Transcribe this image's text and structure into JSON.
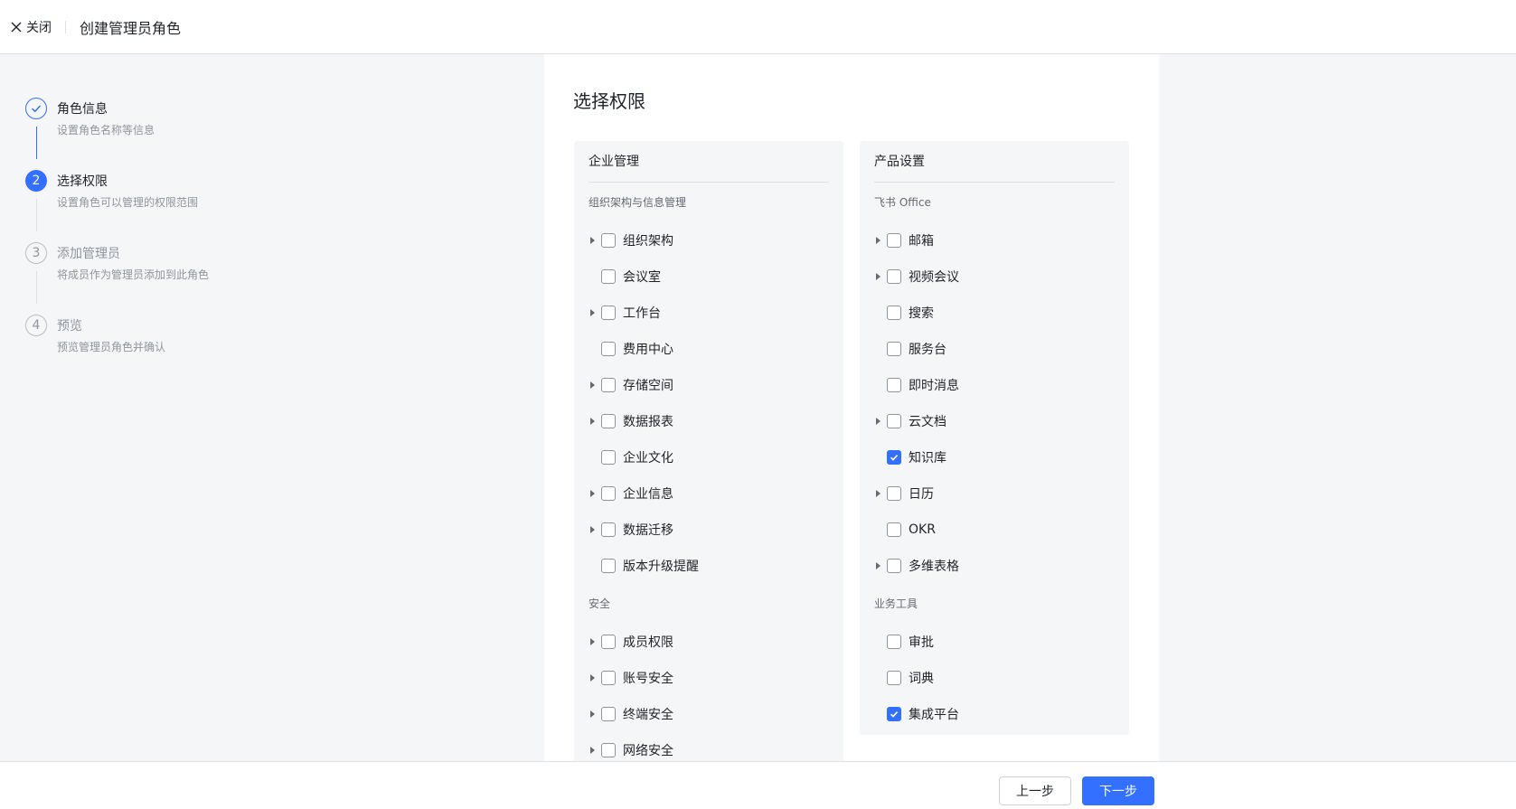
{
  "header": {
    "close_label": "关闭",
    "title": "创建管理员角色"
  },
  "steps": [
    {
      "title": "角色信息",
      "desc": "设置角色名称等信息",
      "status": "done"
    },
    {
      "number": "2",
      "title": "选择权限",
      "desc": "设置角色可以管理的权限范围",
      "status": "active"
    },
    {
      "number": "3",
      "title": "添加管理员",
      "desc": "将成员作为管理员添加到此角色",
      "status": "pending"
    },
    {
      "number": "4",
      "title": "预览",
      "desc": "预览管理员角色并确认",
      "status": "pending"
    }
  ],
  "main": {
    "title": "选择权限",
    "left_panel": {
      "header": "企业管理",
      "groups": [
        {
          "label": "组织架构与信息管理",
          "items": [
            {
              "label": "组织架构",
              "expandable": true,
              "checked": false
            },
            {
              "label": "会议室",
              "expandable": false,
              "checked": false
            },
            {
              "label": "工作台",
              "expandable": true,
              "checked": false
            },
            {
              "label": "费用中心",
              "expandable": false,
              "checked": false
            },
            {
              "label": "存储空间",
              "expandable": true,
              "checked": false
            },
            {
              "label": "数据报表",
              "expandable": true,
              "checked": false
            },
            {
              "label": "企业文化",
              "expandable": false,
              "checked": false
            },
            {
              "label": "企业信息",
              "expandable": true,
              "checked": false
            },
            {
              "label": "数据迁移",
              "expandable": true,
              "checked": false
            },
            {
              "label": "版本升级提醒",
              "expandable": false,
              "checked": false
            }
          ]
        },
        {
          "label": "安全",
          "items": [
            {
              "label": "成员权限",
              "expandable": true,
              "checked": false
            },
            {
              "label": "账号安全",
              "expandable": true,
              "checked": false
            },
            {
              "label": "终端安全",
              "expandable": true,
              "checked": false
            },
            {
              "label": "网络安全",
              "expandable": true,
              "checked": false
            }
          ]
        }
      ]
    },
    "right_panel": {
      "header": "产品设置",
      "groups": [
        {
          "label": "飞书 Office",
          "items": [
            {
              "label": "邮箱",
              "expandable": true,
              "checked": false
            },
            {
              "label": "视频会议",
              "expandable": true,
              "checked": false
            },
            {
              "label": "搜索",
              "expandable": false,
              "checked": false
            },
            {
              "label": "服务台",
              "expandable": false,
              "checked": false
            },
            {
              "label": "即时消息",
              "expandable": false,
              "checked": false
            },
            {
              "label": "云文档",
              "expandable": true,
              "checked": false
            },
            {
              "label": "知识库",
              "expandable": false,
              "checked": true
            },
            {
              "label": "日历",
              "expandable": true,
              "checked": false
            },
            {
              "label": "OKR",
              "expandable": false,
              "checked": false
            },
            {
              "label": "多维表格",
              "expandable": true,
              "checked": false
            }
          ]
        },
        {
          "label": "业务工具",
          "items": [
            {
              "label": "审批",
              "expandable": false,
              "checked": false
            },
            {
              "label": "词典",
              "expandable": false,
              "checked": false
            },
            {
              "label": "集成平台",
              "expandable": false,
              "checked": true
            }
          ]
        }
      ]
    }
  },
  "footer": {
    "prev_label": "上一步",
    "next_label": "下一步"
  },
  "colors": {
    "primary": "#3370ff",
    "border": "#dee0e3",
    "muted": "#8f959e"
  }
}
